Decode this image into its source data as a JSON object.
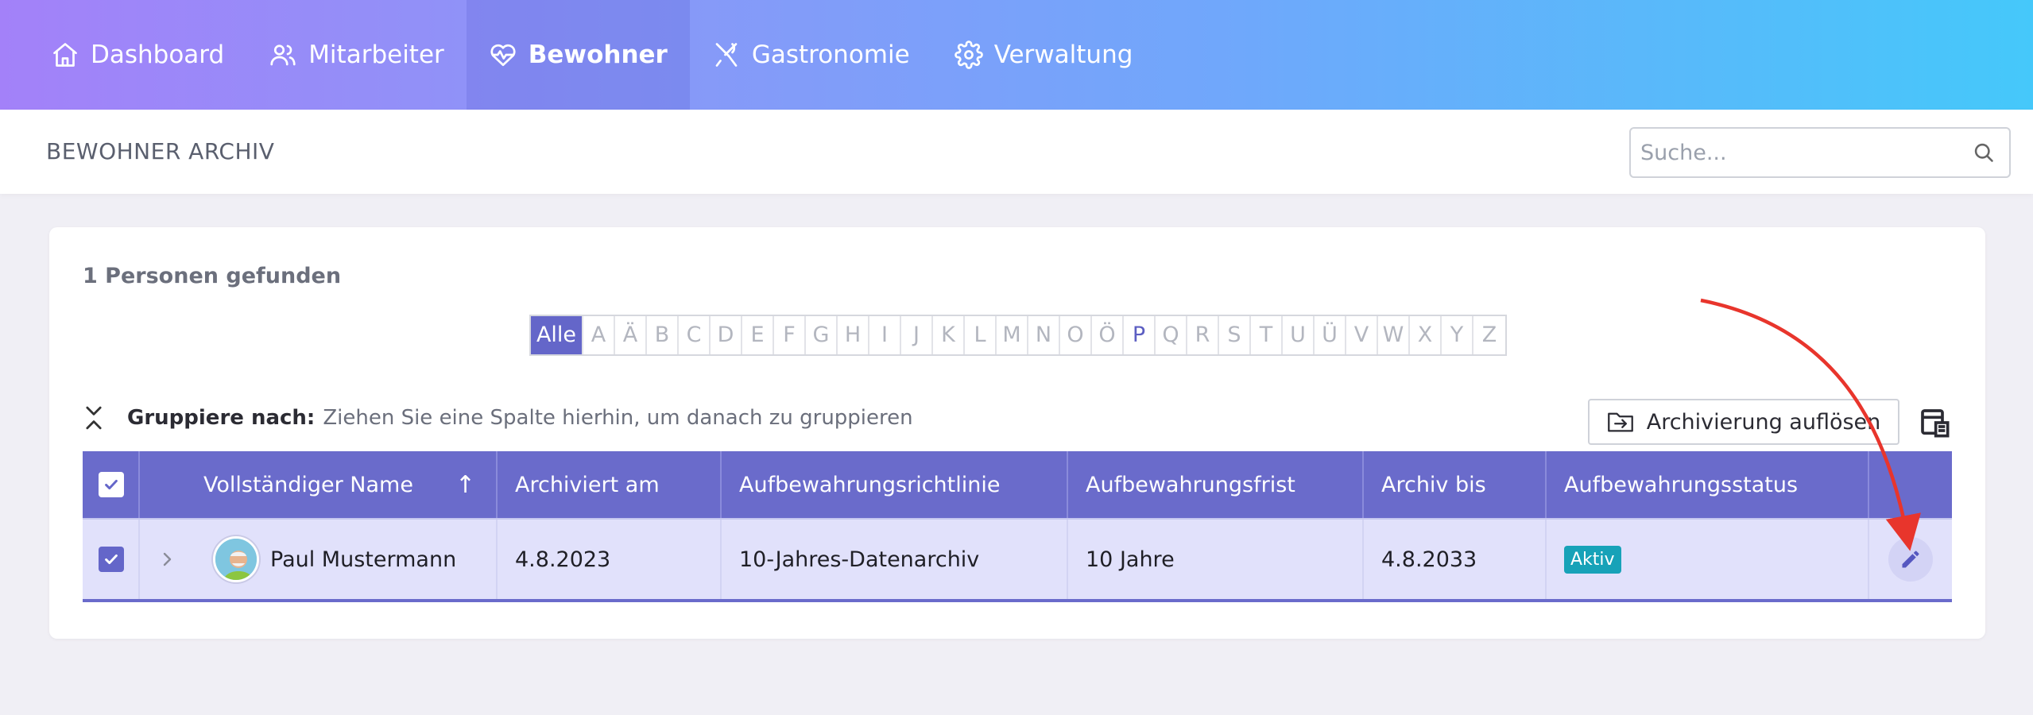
{
  "nav": {
    "items": [
      {
        "label": "Dashboard",
        "icon": "home-icon",
        "active": false
      },
      {
        "label": "Mitarbeiter",
        "icon": "users-icon",
        "active": false
      },
      {
        "label": "Bewohner",
        "icon": "heart-pulse-icon",
        "active": true
      },
      {
        "label": "Gastronomie",
        "icon": "fork-knife-icon",
        "active": false
      },
      {
        "label": "Verwaltung",
        "icon": "gear-icon",
        "active": false
      }
    ]
  },
  "header": {
    "title": "BEWOHNER ARCHIV",
    "search_placeholder": "Suche..."
  },
  "card": {
    "count_text": "1 Personen gefunden",
    "alphabet": {
      "all_label": "Alle",
      "letters": [
        "A",
        "Ä",
        "B",
        "C",
        "D",
        "E",
        "F",
        "G",
        "H",
        "I",
        "J",
        "K",
        "L",
        "M",
        "N",
        "O",
        "Ö",
        "P",
        "Q",
        "R",
        "S",
        "T",
        "U",
        "Ü",
        "V",
        "W",
        "X",
        "Y",
        "Z"
      ],
      "highlighted": [
        "P"
      ]
    },
    "group_by": {
      "label": "Gruppiere nach:",
      "hint": "Ziehen Sie eine Spalte hierhin, um danach zu gruppieren"
    },
    "unarchive_button": "Archivierung auflösen"
  },
  "table": {
    "columns": [
      "Vollständiger Name",
      "Archiviert am",
      "Aufbewahrungsrichtlinie",
      "Aufbewahrungsfrist",
      "Archiv bis",
      "Aufbewahrungsstatus"
    ],
    "sort_indicator": "↑",
    "rows": [
      {
        "name": "Paul Mustermann",
        "archived_on": "4.8.2023",
        "policy": "10-Jahres-Datenarchiv",
        "period": "10 Jahre",
        "archive_until": "4.8.2033",
        "status": "Aktiv"
      }
    ]
  },
  "colors": {
    "accent": "#6a6bcb",
    "row_selected": "#e1e1fb",
    "badge": "#17a2b8",
    "annotation_arrow": "#e8352c"
  }
}
